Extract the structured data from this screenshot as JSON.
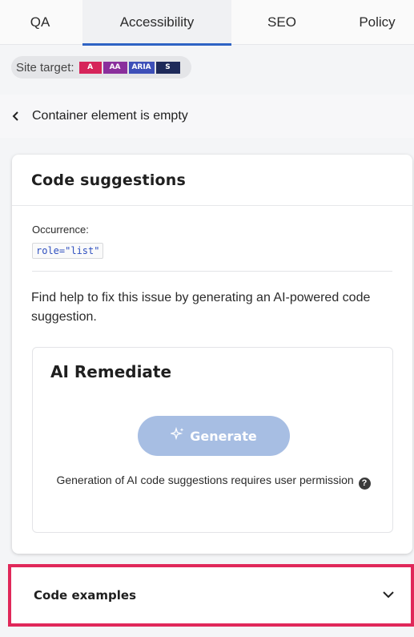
{
  "tabs": [
    {
      "label": "QA",
      "active": false
    },
    {
      "label": "Accessibility",
      "active": true
    },
    {
      "label": "SEO",
      "active": false
    },
    {
      "label": "Policy",
      "active": false
    }
  ],
  "site_target": {
    "label": "Site target:",
    "badges": [
      {
        "text": "A",
        "color": "#d6245a"
      },
      {
        "text": "AA",
        "color": "#8a2f9c"
      },
      {
        "text": "ARIA",
        "color": "#3d4fb8"
      },
      {
        "text": "S",
        "color": "#1e2a5a"
      }
    ]
  },
  "issue": {
    "back_icon": "chevron-left-icon",
    "title": "Container element is empty"
  },
  "code_suggestions": {
    "heading": "Code suggestions",
    "occurrence_label": "Occurrence:",
    "occurrence_code": "role=\"list\"",
    "help_text": "Find help to fix this issue by generating an AI-powered code suggestion.",
    "ai_remediate": {
      "title": "AI Remediate",
      "generate_label": "Generate",
      "generate_icon": "sparkle-icon",
      "permission_text": "Generation of AI code suggestions requires user permission",
      "help_icon": "question-circle-icon"
    }
  },
  "code_examples": {
    "label": "Code examples",
    "icon": "chevron-down-icon"
  },
  "colors": {
    "accent": "#2e63c4",
    "generate_button": "#a7bee3",
    "highlight_border": "#e0285a"
  }
}
